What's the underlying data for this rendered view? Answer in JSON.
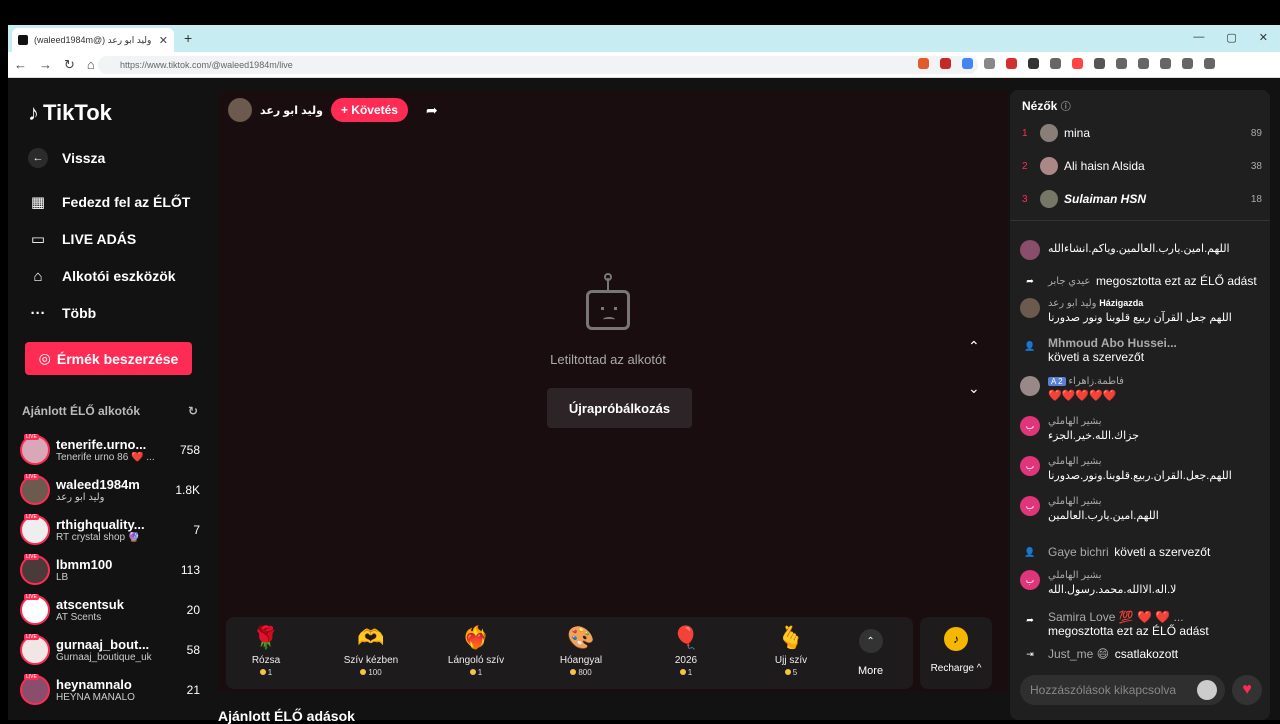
{
  "browser": {
    "tab_title": "(waleed1984m@) وليد ابو رعد",
    "url": "https://www.tiktok.com/@waleed1984m/live"
  },
  "sidebar": {
    "logo": "TikTok",
    "back": "Vissza",
    "nav": [
      {
        "label": "Fedezd fel az ÉLŐT",
        "icon": "calendar-icon"
      },
      {
        "label": "LIVE ADÁS",
        "icon": "camera-icon"
      },
      {
        "label": "Alkotói eszközök",
        "icon": "house-icon"
      },
      {
        "label": "Több",
        "icon": "more-icon"
      }
    ],
    "coins_button": "Érmék beszerzése",
    "recommended_header": "Ajánlott ÉLŐ alkotók",
    "creators": [
      {
        "name": "tenerife.urno...",
        "sub": "Tenerife urno 86 ❤️ ...",
        "count": "758"
      },
      {
        "name": "waleed1984m",
        "sub": "وليد ابو رعد",
        "count": "1.8K"
      },
      {
        "name": "rthighquality...",
        "sub": "RT crystal shop 🔮",
        "count": "7"
      },
      {
        "name": "lbmm100",
        "sub": "LB",
        "count": "113"
      },
      {
        "name": "atscentsuk",
        "sub": "AT Scents",
        "count": "20"
      },
      {
        "name": "gurnaaj_bout...",
        "sub": "Gurnaaj_boutique_uk",
        "count": "58"
      },
      {
        "name": "heynamnalo",
        "sub": "HEYNA MANALO",
        "count": "21"
      }
    ]
  },
  "main": {
    "host_name": "وليد ابو رعد",
    "follow_label": "+ Követés",
    "blocked_message": "Letiltottad az alkotót",
    "retry_label": "Újrapróbálkozás",
    "gifts": [
      {
        "name": "Rózsa",
        "price": "1",
        "emoji": "🌹"
      },
      {
        "name": "Szív kézben",
        "price": "100",
        "emoji": "🫶"
      },
      {
        "name": "Lángoló szív",
        "price": "1",
        "emoji": "❤️‍🔥"
      },
      {
        "name": "Hóangyal",
        "price": "800",
        "emoji": "🎨"
      },
      {
        "name": "2026",
        "price": "1",
        "emoji": "🎈"
      },
      {
        "name": "Ujj szív",
        "price": "5",
        "emoji": "🫰"
      }
    ],
    "more_label": "More",
    "recharge_label": "Recharge ^",
    "recommended_live_title": "Ajánlott ÉLŐ adások"
  },
  "side": {
    "viewers_title": "Nézők",
    "viewers": [
      {
        "rank": "1",
        "name": "mina",
        "points": "89"
      },
      {
        "rank": "2",
        "name": "Ali haisn Alsida",
        "points": "38"
      },
      {
        "rank": "3",
        "name": "Sulaiman HSN",
        "points": "18"
      }
    ],
    "chat": [
      {
        "type": "comment",
        "user": "",
        "text": "اللهم.امين.يارب.العالمين.وياكم.انشاءالله"
      },
      {
        "type": "system",
        "user": "عيدي جابر",
        "text": "megosztotta ezt az ÉLŐ adást"
      },
      {
        "type": "comment",
        "user": "وليد ابو رعد",
        "badge": "Házigazda",
        "text": "اللهم جعل القرآن ربيع قلوبنا ونور صدورنا"
      },
      {
        "type": "system2",
        "user": "Mhmoud Abo Hussei...",
        "text": "követi a szervezőt"
      },
      {
        "type": "comment",
        "user": "فاطمة.زاهراء",
        "badge": "A 2",
        "text": "❤️❤️❤️❤️❤️"
      },
      {
        "type": "comment",
        "user": "بشير الهاملي",
        "text": "جزاك.الله.خير.الجزء"
      },
      {
        "type": "comment",
        "user": "بشير الهاملي",
        "text": "اللهم.جعل.القران.ربيع.قلوبنا.ونور.صدورنا"
      },
      {
        "type": "comment",
        "user": "بشير الهاملي",
        "text": "اللهم.امين.يارب.العالمين"
      },
      {
        "type": "system",
        "user": "Gaye bichri",
        "text": "követi a szervezőt"
      },
      {
        "type": "comment",
        "user": "بشير الهاملي",
        "text": "لا.اله.الاالله.محمد.رسول.الله"
      },
      {
        "type": "system2",
        "user": "Samira Love 💯 ❤️ ❤️ ...",
        "text": "megosztotta ezt az ÉLŐ adást"
      },
      {
        "type": "system",
        "user": "Just_me 😄",
        "text": "csatlakozott"
      }
    ],
    "comment_placeholder": "Hozzászólások kikapcsolva"
  }
}
